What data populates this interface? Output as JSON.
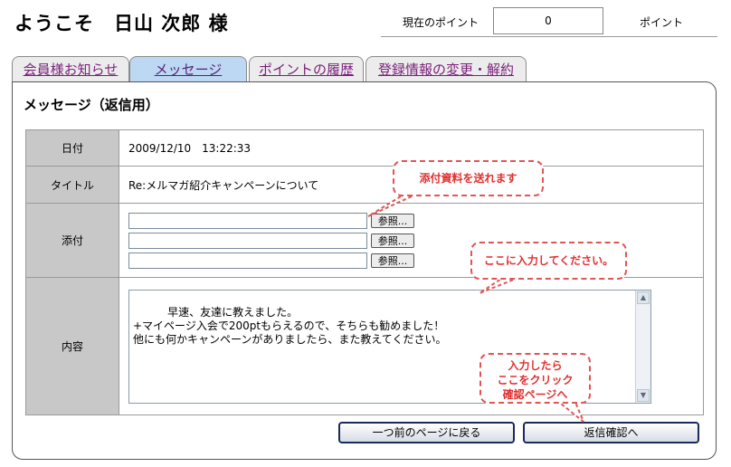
{
  "header": {
    "greeting": "ようこそ　日山 次郎 様",
    "points_label": "現在のポイント",
    "points_value": "0",
    "points_unit": "ポイント"
  },
  "tabs": [
    {
      "label": "会員様お知らせ",
      "active": false
    },
    {
      "label": "メッセージ",
      "active": true
    },
    {
      "label": "ポイントの履歴",
      "active": false
    },
    {
      "label": "登録情報の変更・解約",
      "active": false
    }
  ],
  "page_title": "メッセージ（返信用）",
  "form": {
    "date_label": "日付",
    "date_value": "2009/12/10　13:22:33",
    "title_label": "タイトル",
    "title_value": "Re:メルマガ紹介キャンペーンについて",
    "attach_label": "添付",
    "browse_label": "参照...",
    "content_label": "内容",
    "content_value": "早速、友達に教えました。\n+マイページ入会で200ptもらえるので、そちらも勧めました！\n他にも何かキャンペーンがありましたら、また教えてください。"
  },
  "buttons": {
    "back_label": "一つ前のページに戻る",
    "confirm_label": "返信確認へ"
  },
  "callouts": {
    "attach": "添付資料を送れます",
    "input": "ここに入力してください。",
    "click": "入力したら\nここをクリック\n確認ページへ"
  },
  "colors": {
    "active_tab": "#bcd8f3",
    "label_cell": "#c8c8c8",
    "callout": "#e05555"
  }
}
